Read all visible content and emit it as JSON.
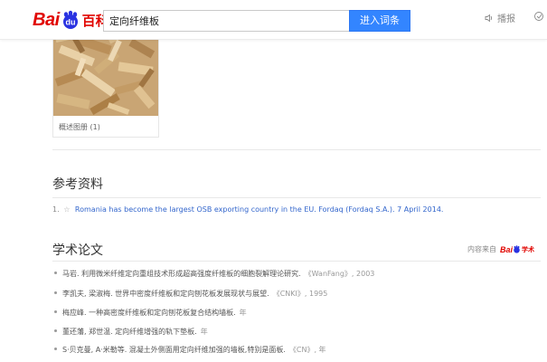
{
  "header": {
    "logo": "Bai du 百科",
    "search_value": "定向纤维板",
    "search_button": "进入词条",
    "play_label": "播报"
  },
  "gallery": {
    "caption": "概述图册 (1)"
  },
  "references": {
    "title": "参考资料",
    "items": [
      {
        "num": "1.",
        "star": "☆",
        "text": "Romania has become the largest OSB exporting country in the EU. Fordaq (Fordaq S.A.). 7 April 2014."
      }
    ]
  },
  "papers": {
    "title": "学术论文",
    "source_label": "内容来自",
    "source_logo": "Bai du 学术",
    "items": [
      {
        "text": "马岩. 利用微米纤维定向重组技术形成超高强度纤维板的细胞裂解理论研究.",
        "source": "《WanFang》, 2003"
      },
      {
        "text": "李凯夫, 梁淑梅. 世界中密度纤维板和定向刨花板发展现状与展望.",
        "source": "《CNKI》, 1995"
      },
      {
        "text": "梅应峰. 一种高密度纤维板和定向刨花板复合结构墙板.",
        "source": "年"
      },
      {
        "text": "董还藩, 郑世温. 定向纤维增强的轨下垫板.",
        "source": "年"
      },
      {
        "text": "S·贝克曼, A·米勒等. 混凝土外侧面用定向纤维加强的墙板,特别是面板.",
        "source": "《CN》, 年"
      }
    ]
  },
  "colors": {
    "brand_red": "#e10602",
    "button_blue": "#3385ff",
    "link_blue": "#3366cc"
  }
}
